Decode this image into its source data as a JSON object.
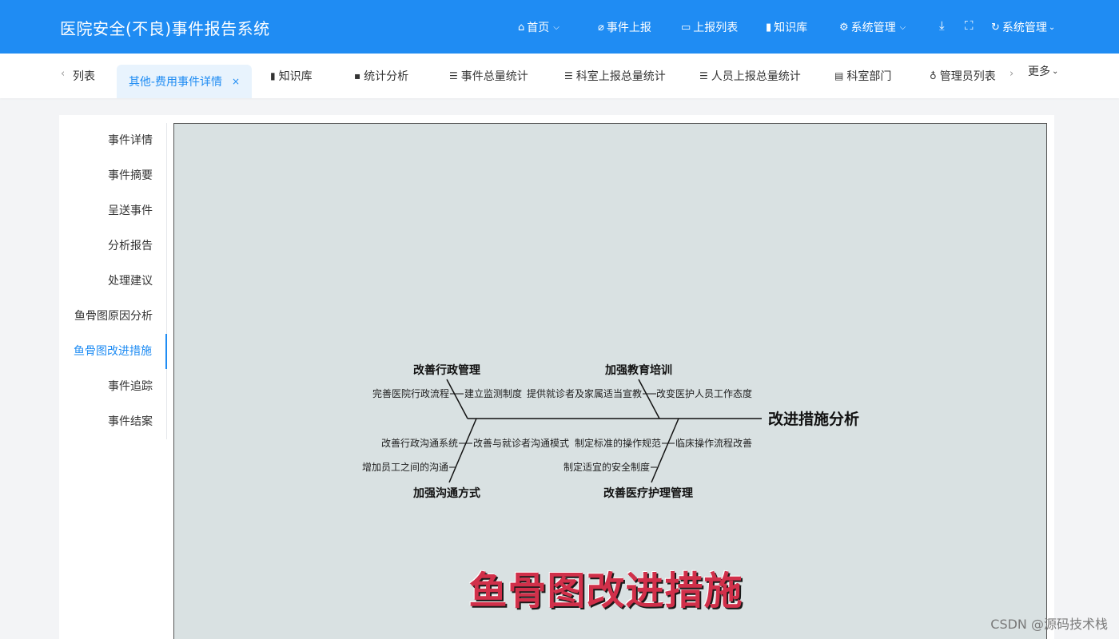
{
  "header": {
    "app_title": "医院安全(不良)事件报告系统",
    "nav": [
      {
        "icon": "home-icon",
        "label": "首页",
        "caret": true
      },
      {
        "icon": "clip-icon",
        "label": "事件上报",
        "caret": false
      },
      {
        "icon": "monitor-icon",
        "label": "上报列表",
        "caret": false
      },
      {
        "icon": "book-icon",
        "label": "知识库",
        "caret": false
      },
      {
        "icon": "gear-icon",
        "label": "系统管理",
        "caret": true
      }
    ],
    "user_menu_label": "系统管理"
  },
  "tabs": {
    "items": [
      {
        "label": "列表"
      },
      {
        "label": "其他-费用事件详情",
        "active": true
      },
      {
        "label": "知识库"
      },
      {
        "label": "统计分析"
      },
      {
        "label": "事件总量统计"
      },
      {
        "label": "科室上报总量统计"
      },
      {
        "label": "人员上报总量统计"
      },
      {
        "label": "科室部门"
      },
      {
        "label": "管理员列表"
      }
    ],
    "more_label": "更多"
  },
  "side_menu": {
    "items": [
      "事件详情",
      "事件摘要",
      "呈送事件",
      "分析报告",
      "处理建议",
      "鱼骨图原因分析",
      "鱼骨图改进措施",
      "事件追踪",
      "事件结案"
    ],
    "active_index": 6
  },
  "fishbone": {
    "head": "改进措施分析",
    "top_left": {
      "title": "改善行政管理",
      "causes": [
        "完善医院行政流程",
        "建立监测制度"
      ]
    },
    "top_right": {
      "title": "加强教育培训",
      "causes": [
        "提供就诊者及家属适当宣教",
        "改变医护人员工作态度"
      ]
    },
    "bottom_left": {
      "title": "加强沟通方式",
      "causes": [
        "改善行政沟通系统",
        "改善与就诊者沟通模式",
        "增加员工之间的沟通"
      ]
    },
    "bottom_right": {
      "title": "改善医疗护理管理",
      "causes": [
        "制定标准的操作规范",
        "临床操作流程改善",
        "制定适宜的安全制度"
      ]
    }
  },
  "overlay_title": "鱼骨图改进措施",
  "watermark": "CSDN @源码技术栈"
}
